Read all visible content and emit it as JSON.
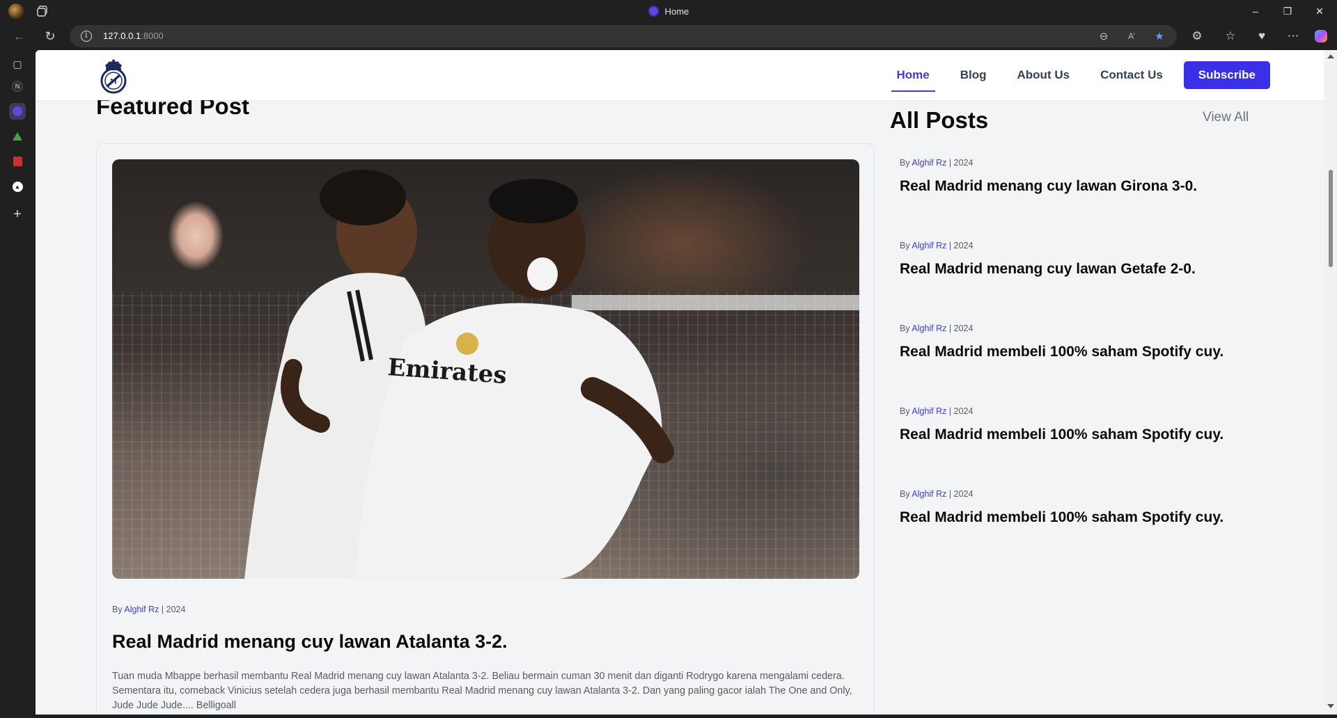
{
  "browser": {
    "tab_title": "Home",
    "url_host": "127.0.0.1",
    "url_port": ":8000"
  },
  "site": {
    "nav": {
      "home": "Home",
      "blog": "Blog",
      "about": "About Us",
      "contact": "Contact Us",
      "subscribe": "Subscribe"
    },
    "featured": {
      "heading": "Featured Post",
      "by": "By",
      "author": "Alghif Rz",
      "sep": "|",
      "year": "2024",
      "title": "Real Madrid menang cuy lawan Atalanta 3-2.",
      "excerpt": "Tuan muda Mbappe berhasil membantu Real Madrid menang cuy lawan Atalanta 3-2. Beliau bermain cuman 30 menit dan diganti Rodrygo karena mengalami cedera. Sementara itu, comeback Vinicius setelah cedera juga berhasil membantu Real Madrid menang cuy lawan Atalanta 3-2. Dan yang paling gacor ialah The One and Only, Jude Jude Jude.... Belligoall"
    },
    "all_posts": {
      "heading": "All Posts",
      "view_all": "View All",
      "items": [
        {
          "by": "By",
          "author": "Alghif Rz",
          "sep": "|",
          "year": "2024",
          "title": "Real Madrid menang cuy lawan Girona 3-0."
        },
        {
          "by": "By",
          "author": "Alghif Rz",
          "sep": "|",
          "year": "2024",
          "title": "Real Madrid menang cuy lawan Getafe 2-0."
        },
        {
          "by": "By",
          "author": "Alghif Rz",
          "sep": "|",
          "year": "2024",
          "title": "Real Madrid membeli 100% saham Spotify cuy."
        },
        {
          "by": "By",
          "author": "Alghif Rz",
          "sep": "|",
          "year": "2024",
          "title": "Real Madrid membeli 100% saham Spotify cuy."
        },
        {
          "by": "By",
          "author": "Alghif Rz",
          "sep": "|",
          "year": "2024",
          "title": "Real Madrid membeli 100% saham Spotify cuy."
        }
      ]
    }
  },
  "colors": {
    "accent": "#3f3bd8",
    "subscribe_bg": "#3b30e8",
    "page_bg": "#f3f4f6"
  }
}
